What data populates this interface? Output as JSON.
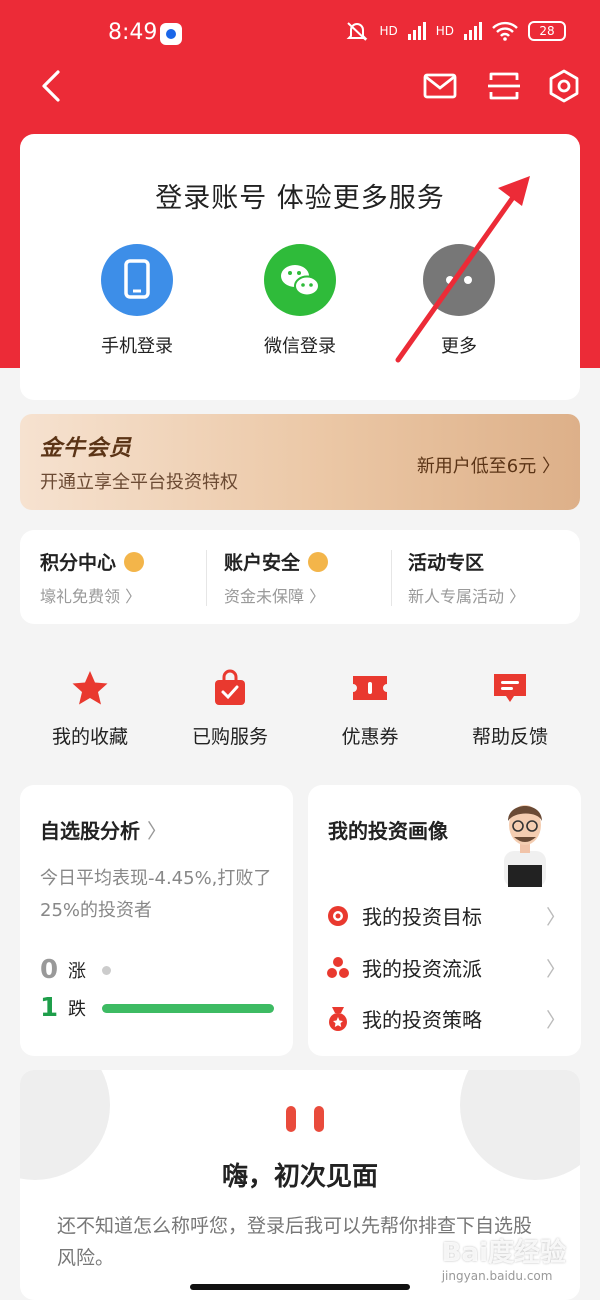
{
  "status_bar": {
    "time": "8:49",
    "battery": "28",
    "hd1": "HD",
    "hd2": "HD"
  },
  "toolbar": {
    "icons": [
      "back-icon",
      "mail-icon",
      "scan-icon",
      "settings-icon"
    ]
  },
  "login_card": {
    "title": "登录账号 体验更多服务",
    "options": [
      {
        "label": "手机登录",
        "icon": "phone-icon",
        "color": "#3d8ee8"
      },
      {
        "label": "微信登录",
        "icon": "wechat-icon",
        "color": "#2fbb3a"
      },
      {
        "label": "更多",
        "icon": "more-icon",
        "color": "#777777"
      }
    ]
  },
  "membership": {
    "logo": "金牛会员",
    "desc": "开通立享全平台投资特权",
    "promo": "新用户低至6元 〉"
  },
  "quick_links": [
    {
      "title": "积分中心",
      "subtitle": "壕礼免费领 〉"
    },
    {
      "title": "账户安全",
      "subtitle": "资金未保障 〉"
    },
    {
      "title": "活动专区",
      "subtitle": "新人专属活动 〉"
    }
  ],
  "feature_icons": [
    {
      "label": "我的收藏",
      "icon": "star-icon"
    },
    {
      "label": "已购服务",
      "icon": "shopping-bag-icon"
    },
    {
      "label": "优惠券",
      "icon": "coupon-icon"
    },
    {
      "label": "帮助反馈",
      "icon": "feedback-icon"
    }
  ],
  "stock_analysis": {
    "title": "自选股分析",
    "chevron": "〉",
    "desc": "今日平均表现-4.45%,打败了25%的投资者",
    "up_count": "0",
    "up_label": "涨",
    "down_count": "1",
    "down_label": "跌",
    "down_fraction": 1.0
  },
  "investment_profile": {
    "title": "我的投资画像",
    "items": [
      {
        "label": "我的投资目标",
        "icon": "target-icon"
      },
      {
        "label": "我的投资流派",
        "icon": "cluster-icon"
      },
      {
        "label": "我的投资策略",
        "icon": "medal-icon"
      }
    ],
    "chevron": "〉"
  },
  "greeting": {
    "title": "嗨，初次见面",
    "desc": "还不知道怎么称呼您，登录后我可以先帮你排查下自选股风险。"
  },
  "watermark": {
    "main": "Bai度经验",
    "sub": "jingyan.baidu.com"
  },
  "colors": {
    "brand_red": "#ec2b37",
    "up_gray": "#999999",
    "down_green": "#1e9e4a",
    "bar_green": "#3dbb63"
  }
}
